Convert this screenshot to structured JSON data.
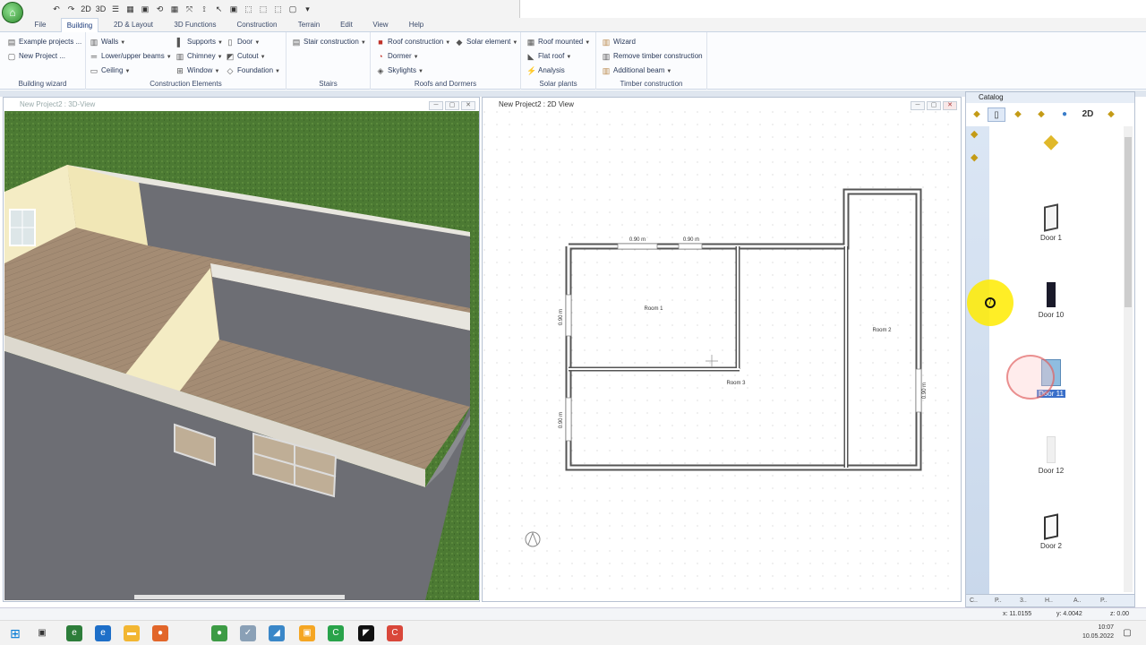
{
  "quick_access": {
    "buttons": [
      "↶",
      "↷",
      "2D",
      "3D",
      "☰",
      "▦",
      "▣",
      "⟲",
      "▦",
      "⤧",
      "⟟",
      "↖",
      "▣",
      "⬚",
      "⬚",
      "⬚",
      "▢",
      "▾"
    ]
  },
  "menu": {
    "tabs": [
      "File",
      "Building",
      "2D & Layout",
      "3D Functions",
      "Construction",
      "Terrain",
      "Edit",
      "View",
      "Help"
    ],
    "active": "Building"
  },
  "ribbon": {
    "building_wizard": {
      "label": "Building wizard",
      "items": [
        "Example projects ...",
        "New Project ..."
      ]
    },
    "construction_elements": {
      "label": "Construction Elements",
      "col1": [
        "Walls",
        "Lower/upper beams",
        "Ceiling"
      ],
      "col2": [
        "Supports",
        "Chimney",
        "Window"
      ],
      "col3": [
        "Door",
        "Cutout",
        "Foundation"
      ]
    },
    "stairs": {
      "label": "Stairs",
      "items": [
        "Stair construction"
      ]
    },
    "roofs": {
      "label": "Roofs and Dormers",
      "col1": [
        "Roof construction",
        "Dormer",
        "Skylights"
      ],
      "col2": [
        "Solar element"
      ]
    },
    "solar": {
      "label": "Solar plants",
      "items": [
        "Roof mounted",
        "Flat roof",
        "Analysis"
      ]
    },
    "timber": {
      "label": "Timber construction",
      "items": [
        "Wizard",
        "Remove timber construction",
        "Additional beam"
      ]
    }
  },
  "view3d": {
    "title": "New Project2 : 3D-View"
  },
  "view2d": {
    "title": "New Project2 : 2D View",
    "rooms": [
      "Room 1",
      "Room 2",
      "Room 3"
    ],
    "dims": [
      "0.90 m",
      "0.90 m",
      "0.90 m",
      "0.90 m",
      "0.90 m"
    ]
  },
  "catalog": {
    "title": "Catalog",
    "items": [
      "Door 1",
      "Door 10",
      "Door 11",
      "Door 12",
      "Door 2"
    ],
    "toolbar_label": "2D",
    "tabs": [
      "C..",
      "P..",
      "3..",
      "H..",
      "A..",
      "P.."
    ]
  },
  "status": {
    "x": "x: 11.0155",
    "y": "y: 4.0042",
    "z": "z: 0.00"
  },
  "taskbar": {
    "time": "10:07",
    "date": "10.05.2022"
  },
  "colors": {
    "accent": "#1a3a7a",
    "wall": "#555555",
    "grass": "#4f7c35",
    "floor": "#a18a72"
  }
}
